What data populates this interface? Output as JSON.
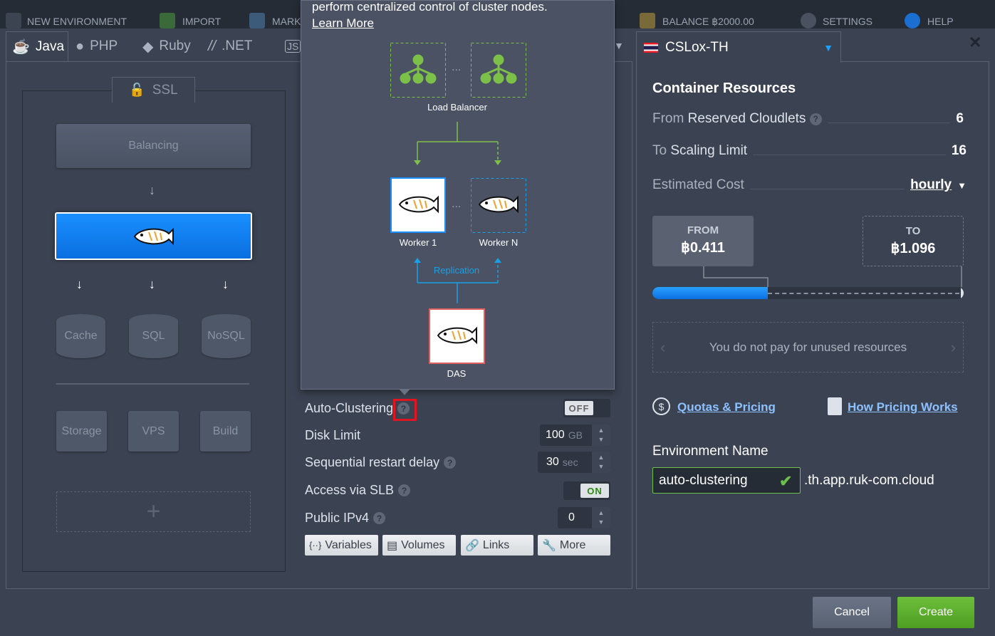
{
  "topbar": {
    "new_env": "NEW ENVIRONMENT",
    "import": "IMPORT",
    "market": "MARK",
    "balance": "BALANCE ฿2000.00",
    "settings": "SETTINGS",
    "help": "HELP"
  },
  "tabs": {
    "java": "Java",
    "php": "PHP",
    "ruby": "Ruby",
    ".net": ".NET",
    "js": "JS"
  },
  "topology": {
    "ssl": "SSL",
    "balancing": "Balancing",
    "cache": "Cache",
    "sql": "SQL",
    "nosql": "NoSQL",
    "storage": "Storage",
    "vps": "VPS",
    "build": "Build",
    "add": "+"
  },
  "tooltip": {
    "text": "perform centralized control of cluster nodes.",
    "learn_more": "Learn More",
    "load_balancer": "Load Balancer",
    "worker1": "Worker 1",
    "workerN": "Worker N",
    "replication": "Replication",
    "das": "DAS",
    "ellipsis": "..."
  },
  "settings": {
    "auto_clustering": {
      "label": "Auto-Clustering",
      "state": "OFF"
    },
    "disk_limit": {
      "label": "Disk Limit",
      "value": "100",
      "unit": "GB"
    },
    "sequential_restart": {
      "label": "Sequential restart delay",
      "value": "30",
      "unit": "sec"
    },
    "access_slb": {
      "label": "Access via SLB",
      "state": "ON"
    },
    "public_ipv4": {
      "label": "Public IPv4",
      "value": "0"
    },
    "help_glyph": "?"
  },
  "buttons": {
    "variables": "Variables",
    "volumes": "Volumes",
    "links": "Links",
    "more": "More"
  },
  "region": {
    "name": "CSLox-TH"
  },
  "resources": {
    "title": "Container Resources",
    "from_a": "From",
    "from_b": "Reserved Cloudlets",
    "from_value": "6",
    "to_a": "To",
    "to_b": "Scaling Limit",
    "to_value": "16",
    "estimated": "Estimated Cost",
    "period": "hourly",
    "from_cost_label": "FROM",
    "from_cost": "฿0.411",
    "to_cost_label": "TO",
    "to_cost": "฿1.096",
    "fill_fraction": 0.37,
    "unused_msg": "You do not pay for unused resources",
    "quotas": "Quotas & Pricing",
    "how_pricing": "How Pricing Works"
  },
  "env": {
    "label": "Environment Name",
    "name": "auto-clustering",
    "domain": ".th.app.ruk-com.cloud"
  },
  "actions": {
    "cancel": "Cancel",
    "create": "Create"
  },
  "colors": {
    "accent": "#1a8fff",
    "create": "#5aab2c",
    "toggle_on": "#3a9a1a"
  }
}
